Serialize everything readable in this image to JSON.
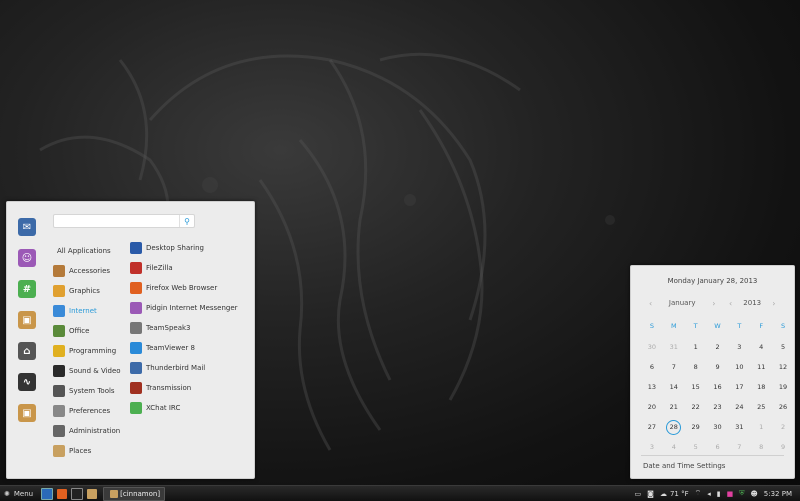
{
  "menu": {
    "search_value": "",
    "favorites": [
      {
        "name": "thunderbird",
        "color": "#3c6aa8",
        "glyph": "✉"
      },
      {
        "name": "pidgin",
        "color": "#9b59b6",
        "glyph": "☺"
      },
      {
        "name": "xchat",
        "color": "#4caf50",
        "glyph": "#"
      },
      {
        "name": "package",
        "color": "#c9964a",
        "glyph": "▣"
      },
      {
        "name": "home",
        "color": "#555555",
        "glyph": "⌂"
      },
      {
        "name": "system-monitor",
        "color": "#333333",
        "glyph": "∿"
      },
      {
        "name": "software",
        "color": "#c9964a",
        "glyph": "▣"
      }
    ],
    "categories": [
      {
        "label": "All Applications",
        "color": "",
        "selected": false
      },
      {
        "label": "Accessories",
        "color": "#b47a3a",
        "selected": false
      },
      {
        "label": "Graphics",
        "color": "#e0a030",
        "selected": false
      },
      {
        "label": "Internet",
        "color": "#3a8ad8",
        "selected": true
      },
      {
        "label": "Office",
        "color": "#5a8a3a",
        "selected": false
      },
      {
        "label": "Programming",
        "color": "#e0b020",
        "selected": false
      },
      {
        "label": "Sound & Video",
        "color": "#2a2a2a",
        "selected": false
      },
      {
        "label": "System Tools",
        "color": "#555555",
        "selected": false
      },
      {
        "label": "Preferences",
        "color": "#888888",
        "selected": false
      },
      {
        "label": "Administration",
        "color": "#666666",
        "selected": false
      },
      {
        "label": "Places",
        "color": "#c8a060",
        "selected": false
      }
    ],
    "apps": [
      {
        "label": "Desktop Sharing",
        "color": "#2a5aa8"
      },
      {
        "label": "FileZilla",
        "color": "#c0302a"
      },
      {
        "label": "Firefox Web Browser",
        "color": "#e06020"
      },
      {
        "label": "Pidgin Internet Messenger",
        "color": "#9b59b6"
      },
      {
        "label": "TeamSpeak3",
        "color": "#777777"
      },
      {
        "label": "TeamViewer 8",
        "color": "#2a8ad8"
      },
      {
        "label": "Thunderbird Mail",
        "color": "#3c6aa8"
      },
      {
        "label": "Transmission",
        "color": "#a03020"
      },
      {
        "label": "XChat IRC",
        "color": "#4caf50"
      }
    ]
  },
  "calendar": {
    "title": "Monday January 28, 2013",
    "month": "January",
    "year": "2013",
    "weekdays": [
      "S",
      "M",
      "T",
      "W",
      "T",
      "F",
      "S"
    ],
    "weeks": [
      [
        {
          "d": "30",
          "dim": true
        },
        {
          "d": "31",
          "dim": true
        },
        {
          "d": "1"
        },
        {
          "d": "2"
        },
        {
          "d": "3"
        },
        {
          "d": "4"
        },
        {
          "d": "5"
        }
      ],
      [
        {
          "d": "6"
        },
        {
          "d": "7"
        },
        {
          "d": "8"
        },
        {
          "d": "9"
        },
        {
          "d": "10"
        },
        {
          "d": "11"
        },
        {
          "d": "12"
        }
      ],
      [
        {
          "d": "13"
        },
        {
          "d": "14"
        },
        {
          "d": "15"
        },
        {
          "d": "16"
        },
        {
          "d": "17"
        },
        {
          "d": "18"
        },
        {
          "d": "19"
        }
      ],
      [
        {
          "d": "20"
        },
        {
          "d": "21"
        },
        {
          "d": "22"
        },
        {
          "d": "23"
        },
        {
          "d": "24"
        },
        {
          "d": "25"
        },
        {
          "d": "26"
        }
      ],
      [
        {
          "d": "27"
        },
        {
          "d": "28",
          "today": true
        },
        {
          "d": "29"
        },
        {
          "d": "30"
        },
        {
          "d": "31"
        },
        {
          "d": "1",
          "dim": true
        },
        {
          "d": "2",
          "dim": true
        }
      ],
      [
        {
          "d": "3",
          "dim": true
        },
        {
          "d": "4",
          "dim": true
        },
        {
          "d": "5",
          "dim": true
        },
        {
          "d": "6",
          "dim": true
        },
        {
          "d": "7",
          "dim": true
        },
        {
          "d": "8",
          "dim": true
        },
        {
          "d": "9",
          "dim": true
        }
      ]
    ],
    "settings_label": "Date and Time Settings"
  },
  "taskbar": {
    "menu_label": "Menu",
    "window_label": "[cinnamon]",
    "temperature": "71 °F",
    "clock": "5:32 PM"
  },
  "accent": "#2a9ad8"
}
